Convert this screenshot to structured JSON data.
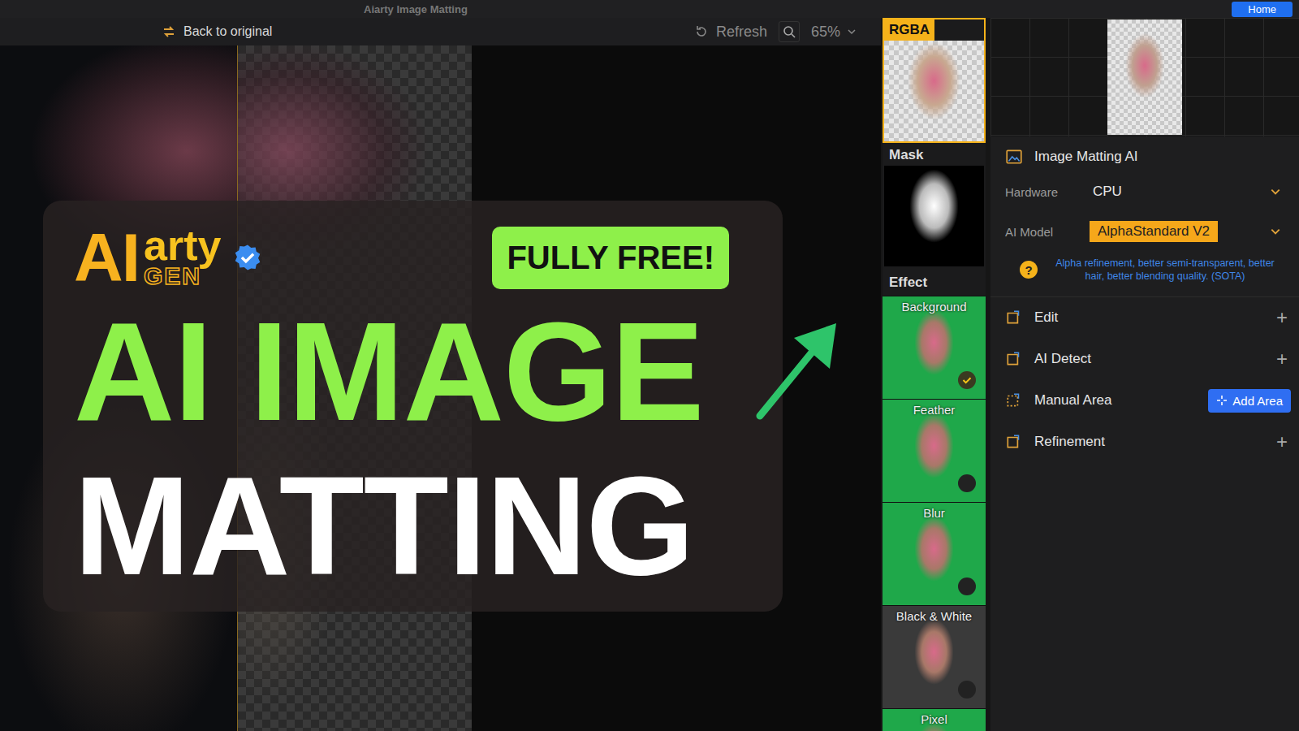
{
  "window": {
    "title": "Aiarty Image Matting",
    "home": "Home"
  },
  "toolbar": {
    "back": "Back to original",
    "refresh": "Refresh",
    "zoom": "65%"
  },
  "overlay": {
    "logo": {
      "ai": "AI",
      "arty": "arty",
      "gen": "GEN",
      "verified": true
    },
    "badge": "FULLY FREE!",
    "headline": [
      "AI IMAGE",
      "MATTING"
    ]
  },
  "views": [
    {
      "label": "RGBA",
      "selected": true
    },
    {
      "label": "Mask",
      "selected": false
    }
  ],
  "effects": {
    "title": "Effect",
    "items": [
      {
        "label": "Background",
        "checked": true
      },
      {
        "label": "Feather",
        "checked": false
      },
      {
        "label": "Blur",
        "checked": false
      },
      {
        "label": "Black & White",
        "checked": false
      },
      {
        "label": "Pixel",
        "checked": false
      }
    ]
  },
  "panel": {
    "title": "Image Matting AI",
    "fields": [
      {
        "label": "Hardware",
        "value": "CPU",
        "highlighted": false
      },
      {
        "label": "AI Model",
        "value": "AlphaStandard V2",
        "highlighted": true
      }
    ],
    "help": {
      "icon": "?",
      "text": "Alpha refinement, better semi-transparent, better hair, better blending quality. (SOTA)"
    },
    "sections": [
      {
        "label": "Edit",
        "kind": "expand",
        "action": "+"
      },
      {
        "label": "AI Detect",
        "kind": "expand",
        "action": "+"
      },
      {
        "label": "Manual Area",
        "kind": "button",
        "action": "Add Area"
      },
      {
        "label": "Refinement",
        "kind": "expand",
        "action": "+"
      }
    ]
  }
}
